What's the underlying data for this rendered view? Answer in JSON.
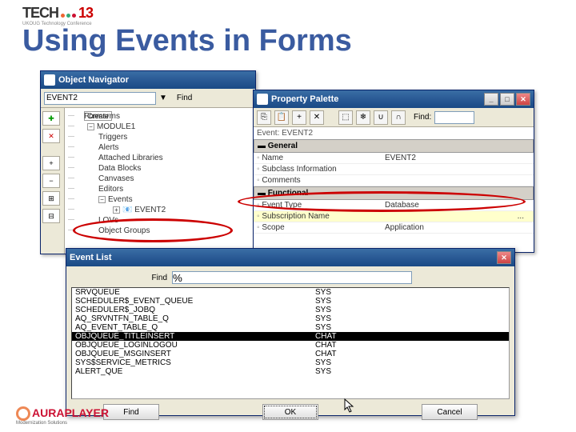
{
  "slide": {
    "brand": "TECH",
    "brand2": "13",
    "subbrand": "UKOUG Technology Conference",
    "title": "Using Events in Forms"
  },
  "objnav": {
    "title": "Object Navigator",
    "find_label": "Find",
    "current": "EVENT2",
    "create_tip": "Create",
    "root": "Forms",
    "items": [
      "MODULE1",
      "Triggers",
      "Alerts",
      "Attached Libraries",
      "Data Blocks",
      "Canvases",
      "Editors",
      "Events",
      "EVENT2",
      "LOVs",
      "Object Groups"
    ]
  },
  "palette": {
    "title": "Property Palette",
    "find_label": "Find:",
    "header": "Event: EVENT2",
    "sections": {
      "general": "General",
      "functional": "Functional"
    },
    "props": {
      "name": {
        "label": "Name",
        "value": "EVENT2"
      },
      "subclass": {
        "label": "Subclass Information",
        "value": ""
      },
      "comments": {
        "label": "Comments",
        "value": ""
      },
      "eventtype": {
        "label": "Event Type",
        "value": "Database"
      },
      "subname": {
        "label": "Subscription Name",
        "value": "..."
      },
      "scope": {
        "label": "Scope",
        "value": "Application"
      }
    }
  },
  "eventlist": {
    "title": "Event List",
    "find_label": "Find",
    "find_value": "%",
    "rows": [
      {
        "n": "SRVQUEUE",
        "o": "SYS"
      },
      {
        "n": "SCHEDULER$_EVENT_QUEUE",
        "o": "SYS"
      },
      {
        "n": "SCHEDULER$_JOBQ",
        "o": "SYS"
      },
      {
        "n": "AQ_SRVNTFN_TABLE_Q",
        "o": "SYS"
      },
      {
        "n": "AQ_EVENT_TABLE_Q",
        "o": "SYS"
      },
      {
        "n": "OBJQUEUE_TITLEINSERT",
        "o": "CHAT"
      },
      {
        "n": "OBJQUEUE_LOGINLOGOU",
        "o": "CHAT"
      },
      {
        "n": "OBJQUEUE_MSGINSERT",
        "o": "CHAT"
      },
      {
        "n": "SYS$SERVICE_METRICS",
        "o": "SYS"
      },
      {
        "n": "ALERT_QUE",
        "o": "SYS"
      }
    ],
    "selected": 5,
    "buttons": {
      "find": "Find",
      "ok": "OK",
      "cancel": "Cancel"
    }
  },
  "footer": {
    "brand": "AURAPLAYER",
    "sub": "Modernization Solutions"
  }
}
